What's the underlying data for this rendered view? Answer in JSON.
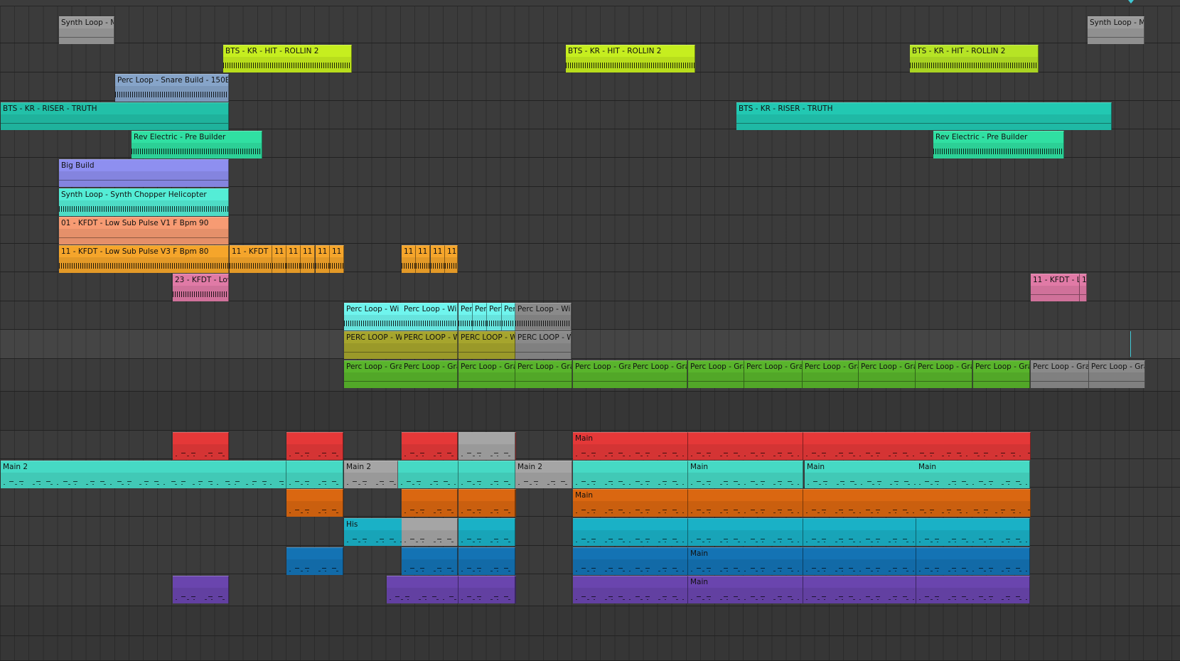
{
  "app": {
    "view": "Arrangement"
  },
  "accent": "#3fc7d4",
  "tracks": [
    {
      "clips": [
        {
          "name": "Synth Loop - M",
          "color": "#9b9b9b",
          "kind": "audio-thin"
        },
        {
          "name": "Synth Loop - M",
          "color": "#9b9b9b",
          "kind": "audio-thin"
        }
      ]
    },
    {
      "clips": [
        {
          "name": "BTS - KR - HIT - ROLLIN 2",
          "color": "#c6ee1f",
          "kind": "audio"
        },
        {
          "name": "BTS - KR - HIT - ROLLIN 2",
          "color": "#c6ee1f",
          "kind": "audio"
        },
        {
          "name": "BTS - KR - HIT - ROLLIN 2",
          "color": "#b6e425",
          "kind": "audio"
        }
      ]
    },
    {
      "clips": [
        {
          "name": "Perc Loop - Snare Build - 150B",
          "color": "#86a4c9",
          "kind": "audio"
        }
      ]
    },
    {
      "clips": [
        {
          "name": "BTS - KR - RISER - TRUTH",
          "color": "#22c0a8",
          "kind": "audio-thin"
        },
        {
          "name": "BTS - KR - RISER - TRUTH",
          "color": "#22c8b2",
          "kind": "audio-thin"
        }
      ]
    },
    {
      "clips": [
        {
          "name": "Rev Electric - Pre Builder",
          "color": "#30e0a2",
          "kind": "audio"
        },
        {
          "name": "Rev Electric - Pre Builder",
          "color": "#30e0a2",
          "kind": "audio"
        }
      ]
    },
    {
      "clips": [
        {
          "name": "Big Build",
          "color": "#8e8ff0",
          "kind": "audio-thin"
        }
      ]
    },
    {
      "clips": [
        {
          "name": "Synth Loop - Synth Chopper Helicopter",
          "color": "#54edd6",
          "kind": "audio"
        }
      ]
    },
    {
      "clips": [
        {
          "name": "01 - KFDT - Low Sub Pulse V1 F Bpm 90",
          "color": "#f79b73",
          "kind": "audio-thin"
        }
      ]
    },
    {
      "clips": [
        {
          "name": "11 - KFDT - Low Sub Pulse V3 F Bpm 80",
          "color": "#f5a52b",
          "kind": "audio"
        },
        {
          "name": "11 - KFDT",
          "color": "#f5a52b",
          "kind": "audio"
        },
        {
          "name": "11",
          "color": "#f5a52b",
          "kind": "audio"
        },
        {
          "name": "11",
          "color": "#f5a52b",
          "kind": "audio"
        },
        {
          "name": "11",
          "color": "#f5a52b",
          "kind": "audio"
        },
        {
          "name": "11",
          "color": "#f5a52b",
          "kind": "audio"
        },
        {
          "name": "11",
          "color": "#f5a52b",
          "kind": "audio"
        },
        {
          "name": "11",
          "color": "#f5a52b",
          "kind": "audio"
        },
        {
          "name": "11",
          "color": "#f5a52b",
          "kind": "audio"
        },
        {
          "name": "11",
          "color": "#f5a52b",
          "kind": "audio"
        },
        {
          "name": "11",
          "color": "#f5a52b",
          "kind": "audio"
        }
      ]
    },
    {
      "clips": [
        {
          "name": "23 - KFDT - Low",
          "color": "#e07aa6",
          "kind": "audio"
        },
        {
          "name": "11 - KFDT - Lo",
          "color": "#e07aa6",
          "kind": "audio-thin"
        },
        {
          "name": "1",
          "color": "#e07aa6",
          "kind": "audio-thin"
        }
      ]
    },
    {
      "clips": [
        {
          "name": "Perc Loop - Wi",
          "color": "#6ff5ee",
          "kind": "audio"
        },
        {
          "name": "Perc Loop - Wi",
          "color": "#6ff5ee",
          "kind": "audio"
        },
        {
          "name": "Per",
          "color": "#6ff5ee",
          "kind": "audio"
        },
        {
          "name": "Per",
          "color": "#6ff5ee",
          "kind": "audio"
        },
        {
          "name": "Per",
          "color": "#6ff5ee",
          "kind": "audio"
        },
        {
          "name": "Per",
          "color": "#6ff5ee",
          "kind": "audio"
        },
        {
          "name": "Perc Loop - Wi",
          "color": "#8a8a8a",
          "kind": "audio"
        }
      ]
    },
    {
      "clips": [
        {
          "name": "PERC LOOP - W",
          "color": "#a6a52d",
          "kind": "audio-thin"
        },
        {
          "name": "PERC LOOP - W",
          "color": "#a6a52d",
          "kind": "audio-thin"
        },
        {
          "name": "PERC LOOP - W",
          "color": "#a6a52d",
          "kind": "audio-thin"
        },
        {
          "name": "PERC LOOP - W",
          "color": "#8a8a8a",
          "kind": "audio-thin"
        }
      ]
    },
    {
      "clips": [
        {
          "name": "Perc Loop - Gra",
          "color": "#59b42c",
          "kind": "audio-thin"
        },
        {
          "name": "Perc Loop - Gra",
          "color": "#59b42c",
          "kind": "audio-thin"
        },
        {
          "name": "Perc Loop - Gra",
          "color": "#59b42c",
          "kind": "audio-thin"
        },
        {
          "name": "Perc Loop - Gra",
          "color": "#59b42c",
          "kind": "audio-thin"
        },
        {
          "name": "Perc Loop - Gra",
          "color": "#59b42c",
          "kind": "audio-thin"
        },
        {
          "name": "Perc Loop - Gra",
          "color": "#59b42c",
          "kind": "audio-thin"
        },
        {
          "name": "Perc Loop - Gra",
          "color": "#59b42c",
          "kind": "audio-thin"
        },
        {
          "name": "Perc Loop - Gra",
          "color": "#59b42c",
          "kind": "audio-thin"
        },
        {
          "name": "Perc Loop - Gra",
          "color": "#59b42c",
          "kind": "audio-thin"
        },
        {
          "name": "Perc Loop - Gra",
          "color": "#59b42c",
          "kind": "audio-thin"
        },
        {
          "name": "Perc Loop - Gra",
          "color": "#59b42c",
          "kind": "audio-thin"
        },
        {
          "name": "Perc Loop - Gra",
          "color": "#59b42c",
          "kind": "audio-thin"
        },
        {
          "name": "Perc Loop - Gra",
          "color": "#8a8a8a",
          "kind": "audio-thin"
        },
        {
          "name": "Perc Loop - Gra",
          "color": "#8a8a8a",
          "kind": "audio-thin"
        }
      ]
    },
    {
      "clips": []
    },
    {
      "clips": [
        {
          "name": "",
          "color": "#e53838",
          "kind": "midi"
        },
        {
          "name": "",
          "color": "#e53838",
          "kind": "midi"
        },
        {
          "name": "",
          "color": "#e53838",
          "kind": "midi"
        },
        {
          "name": "",
          "color": "#a5a5a5",
          "kind": "midi"
        },
        {
          "name": "",
          "color": "#e53838",
          "kind": "midi"
        },
        {
          "name": "Main",
          "color": "#e53838",
          "kind": "midi"
        },
        {
          "name": "",
          "color": "#e53838",
          "kind": "midi"
        },
        {
          "name": "",
          "color": "#e53838",
          "kind": "midi"
        }
      ]
    },
    {
      "clips": [
        {
          "name": "Main 2",
          "color": "#46d9c4",
          "kind": "midi"
        },
        {
          "name": "",
          "color": "#46d9c4",
          "kind": "midi"
        },
        {
          "name": "Main 2",
          "color": "#a5a5a5",
          "kind": "midi"
        },
        {
          "name": "",
          "color": "#46d9c4",
          "kind": "midi"
        },
        {
          "name": "",
          "color": "#46d9c4",
          "kind": "midi"
        },
        {
          "name": "Main 2",
          "color": "#a5a5a5",
          "kind": "midi"
        },
        {
          "name": "",
          "color": "#46d9c4",
          "kind": "midi"
        },
        {
          "name": "Main",
          "color": "#46d9c4",
          "kind": "midi"
        },
        {
          "name": "Main",
          "color": "#46d9c4",
          "kind": "midi"
        },
        {
          "name": "Main",
          "color": "#46d9c4",
          "kind": "midi"
        }
      ]
    },
    {
      "clips": [
        {
          "name": "",
          "color": "#da6711",
          "kind": "midi"
        },
        {
          "name": "",
          "color": "#da6711",
          "kind": "midi"
        },
        {
          "name": "",
          "color": "#da6711",
          "kind": "midi"
        },
        {
          "name": "",
          "color": "#da6711",
          "kind": "midi"
        },
        {
          "name": "Main",
          "color": "#da6711",
          "kind": "midi"
        },
        {
          "name": "",
          "color": "#da6711",
          "kind": "midi"
        },
        {
          "name": "",
          "color": "#da6711",
          "kind": "midi"
        }
      ]
    },
    {
      "clips": [
        {
          "name": "His",
          "color": "#1ab1c6",
          "kind": "midi"
        },
        {
          "name": "",
          "color": "#a5a5a5",
          "kind": "midi"
        },
        {
          "name": "",
          "color": "#1ab1c6",
          "kind": "midi"
        },
        {
          "name": "",
          "color": "#1ab1c6",
          "kind": "midi"
        },
        {
          "name": "",
          "color": "#1ab1c6",
          "kind": "midi"
        },
        {
          "name": "",
          "color": "#1ab1c6",
          "kind": "midi"
        },
        {
          "name": "",
          "color": "#1ab1c6",
          "kind": "midi"
        }
      ]
    },
    {
      "clips": [
        {
          "name": "",
          "color": "#1473b4",
          "kind": "midi"
        },
        {
          "name": "",
          "color": "#1473b4",
          "kind": "midi"
        },
        {
          "name": "",
          "color": "#1473b4",
          "kind": "midi"
        },
        {
          "name": "",
          "color": "#1473b4",
          "kind": "midi"
        },
        {
          "name": "Main",
          "color": "#1473b4",
          "kind": "midi"
        },
        {
          "name": "",
          "color": "#1473b4",
          "kind": "midi"
        },
        {
          "name": "",
          "color": "#1473b4",
          "kind": "midi"
        }
      ]
    },
    {
      "clips": [
        {
          "name": "",
          "color": "#6a45ae",
          "kind": "midi"
        },
        {
          "name": "",
          "color": "#6a45ae",
          "kind": "midi"
        },
        {
          "name": "",
          "color": "#6a45ae",
          "kind": "midi"
        },
        {
          "name": "",
          "color": "#6a45ae",
          "kind": "midi"
        },
        {
          "name": "",
          "color": "#6a45ae",
          "kind": "midi"
        },
        {
          "name": "Main",
          "color": "#6a45ae",
          "kind": "midi"
        },
        {
          "name": "",
          "color": "#6a45ae",
          "kind": "midi"
        },
        {
          "name": "",
          "color": "#6a45ae",
          "kind": "midi"
        }
      ]
    },
    {
      "clips": []
    },
    {
      "clips": []
    }
  ]
}
